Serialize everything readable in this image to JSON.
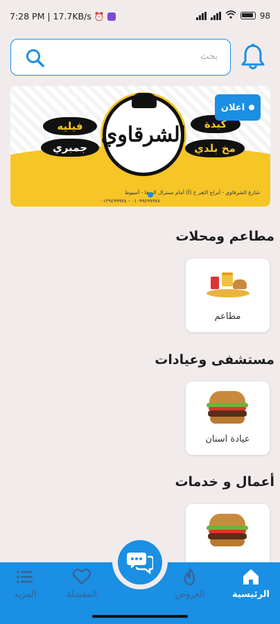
{
  "status_bar": {
    "time_info": "7:28 PM | 17.7KB/s",
    "alarm_icon": "alarm-clock-icon",
    "battery": "98"
  },
  "header": {
    "search_placeholder": "بحث",
    "search_icon": "search-icon",
    "bell_icon": "bell-icon"
  },
  "banner": {
    "ad_label": "اعلان",
    "logo_text": "الشرقاوي",
    "pills": [
      "فيليه",
      "جمبري",
      "كبدة",
      "مخ بلدي"
    ],
    "address": "شارع الشرقاوي - أبراج الثغر ح (أ) أمام سنترال الصفا - أسيوط",
    "phones": "٠١٠٩٩٤٩٩٩٧٨ - ٠١٢٩٤٩٩٩٧٨"
  },
  "sections": [
    {
      "title": "مطاعم ومحلات",
      "card_label": "مطاعم",
      "card_image": "fast-food-image"
    },
    {
      "title": "مستشفى وعيادات",
      "card_label": "عيادة اسنان",
      "card_image": "burger-image"
    },
    {
      "title": "أعمال و خدمات",
      "card_label": "",
      "card_image": "burger-image"
    }
  ],
  "bottom_nav": {
    "items": [
      {
        "label": "الرئيسية",
        "icon": "home-icon",
        "active": true
      },
      {
        "label": "العروض",
        "icon": "fire-icon",
        "active": false
      },
      {
        "label": "المفضلة",
        "icon": "heart-icon",
        "active": false
      },
      {
        "label": "المزيد",
        "icon": "menu-icon",
        "active": false
      }
    ],
    "fab_icon": "chat-bubbles-icon"
  },
  "colors": {
    "primary": "#1a8fe3",
    "background": "#f1eceb",
    "banner_yellow": "#f6c526"
  }
}
